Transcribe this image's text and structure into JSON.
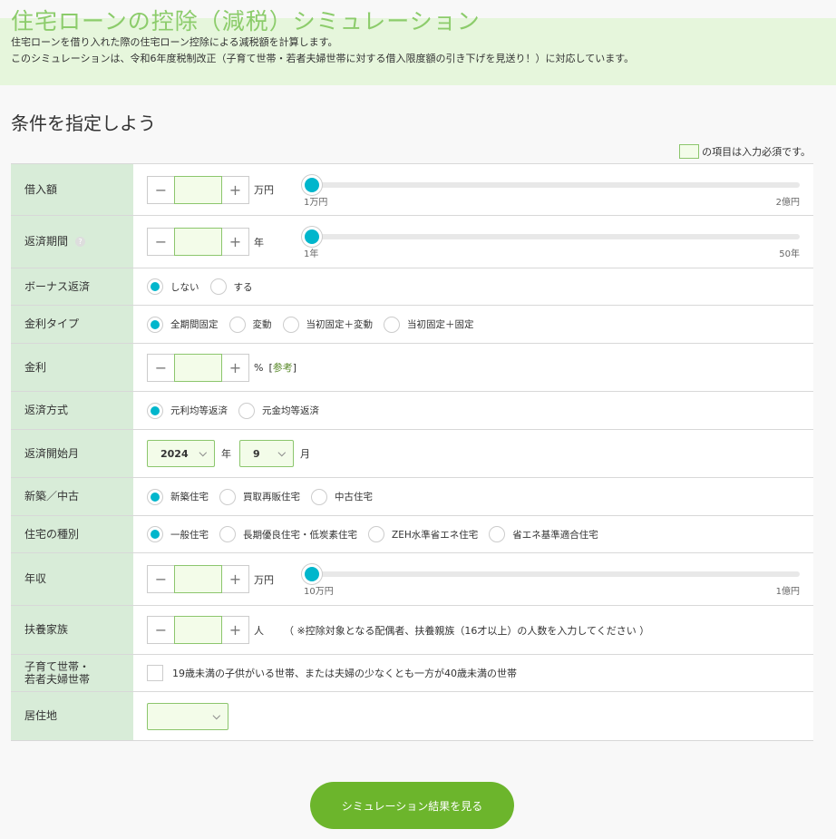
{
  "header": {
    "title": "住宅ローンの控除（減税）シミュレーション",
    "desc1": "住宅ローンを借り入れた際の住宅ローン控除による減税額を計算します。",
    "desc2": "このシミュレーションは、令和6年度税制改正（子育て世帯・若者夫婦世帯に対する借入限度額の引き下げを見送り！）に対応しています。"
  },
  "section_title": "条件を指定しよう",
  "legend_text": "の項目は入力必須です。",
  "stepper": {
    "minus": "−",
    "plus": "+"
  },
  "loan": {
    "label": "借入額",
    "unit": "万円",
    "min": "1万円",
    "max": "2億円",
    "value_fraction": 0
  },
  "term": {
    "label": "返済期間",
    "help": "?",
    "unit": "年",
    "min": "1年",
    "max": "50年",
    "value_fraction": 0
  },
  "bonus": {
    "label": "ボーナス返済",
    "options": [
      "しない",
      "する"
    ],
    "selected": 0
  },
  "rate_type": {
    "label": "金利タイプ",
    "options": [
      "全期間固定",
      "変動",
      "当初固定＋変動",
      "当初固定＋固定"
    ],
    "selected": 0
  },
  "rate": {
    "label": "金利",
    "unit": "%",
    "ref_open": "[",
    "ref": "参考",
    "ref_close": "]"
  },
  "method": {
    "label": "返済方式",
    "options": [
      "元利均等返済",
      "元金均等返済"
    ],
    "selected": 0
  },
  "start": {
    "label": "返済開始月",
    "year": "2024",
    "year_unit": "年",
    "month": "9",
    "month_unit": "月"
  },
  "new_used": {
    "label": "新築／中古",
    "options": [
      "新築住宅",
      "買取再販住宅",
      "中古住宅"
    ],
    "selected": 0
  },
  "house_type": {
    "label": "住宅の種別",
    "options": [
      "一般住宅",
      "長期優良住宅・低炭素住宅",
      "ZEH水準省エネ住宅",
      "省エネ基準適合住宅"
    ],
    "selected": 0
  },
  "income": {
    "label": "年収",
    "unit": "万円",
    "min": "10万円",
    "max": "1億円",
    "value_fraction": 0
  },
  "dependents": {
    "label": "扶養家族",
    "unit": "人",
    "note": "（ ※控除対象となる配偶者、扶養親族（16才以上）の人数を入力してください ）"
  },
  "family": {
    "label1": "子育て世帯・",
    "label2": "若者夫婦世帯",
    "text": "19歳未満の子供がいる世帯、または夫婦の少なくとも一方が40歳未満の世帯"
  },
  "residence": {
    "label": "居住地",
    "value": ""
  },
  "submit_label": "シミュレーション結果を見る",
  "colors": {
    "accent": "#00b6cc",
    "button": "#6cb52c",
    "label_bg": "#d8ecd8",
    "title": "#8ccc6b"
  }
}
